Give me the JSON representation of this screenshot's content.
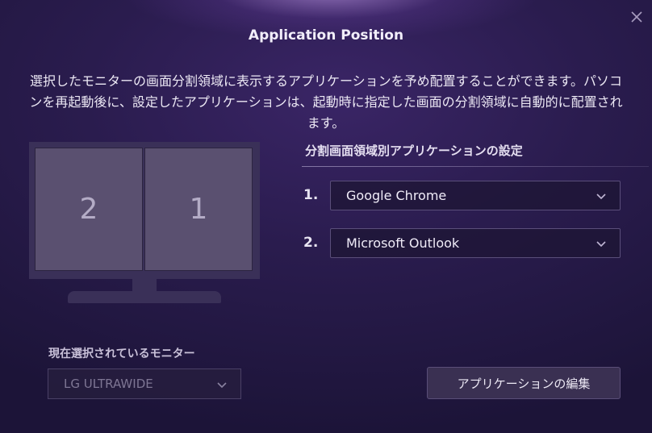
{
  "dialog": {
    "title": "Application Position",
    "description": "選択したモニターの画面分割領域に表示するアプリケーションを予め配置することができます。パソコンを再起動後に、設定したアプリケーションは、起動時に指定した画面の分割領域に自動的に配置されます。"
  },
  "monitor_preview": {
    "left_region": "2",
    "right_region": "1"
  },
  "settings": {
    "heading": "分割画面領域別アプリケーションの設定",
    "rows": [
      {
        "number": "1.",
        "app": "Google Chrome"
      },
      {
        "number": "2.",
        "app": "Microsoft Outlook"
      }
    ]
  },
  "current_monitor": {
    "label": "現在選択されているモニター",
    "value": "LG ULTRAWIDE"
  },
  "actions": {
    "edit_label": "アプリケーションの編集"
  },
  "icons": {
    "close": "close-icon",
    "dropdown": "chevron-down-icon"
  },
  "colors": {
    "background": "#2a1c4e",
    "accent_glow": "#d6aaff",
    "screen_region": "#5a5070"
  }
}
